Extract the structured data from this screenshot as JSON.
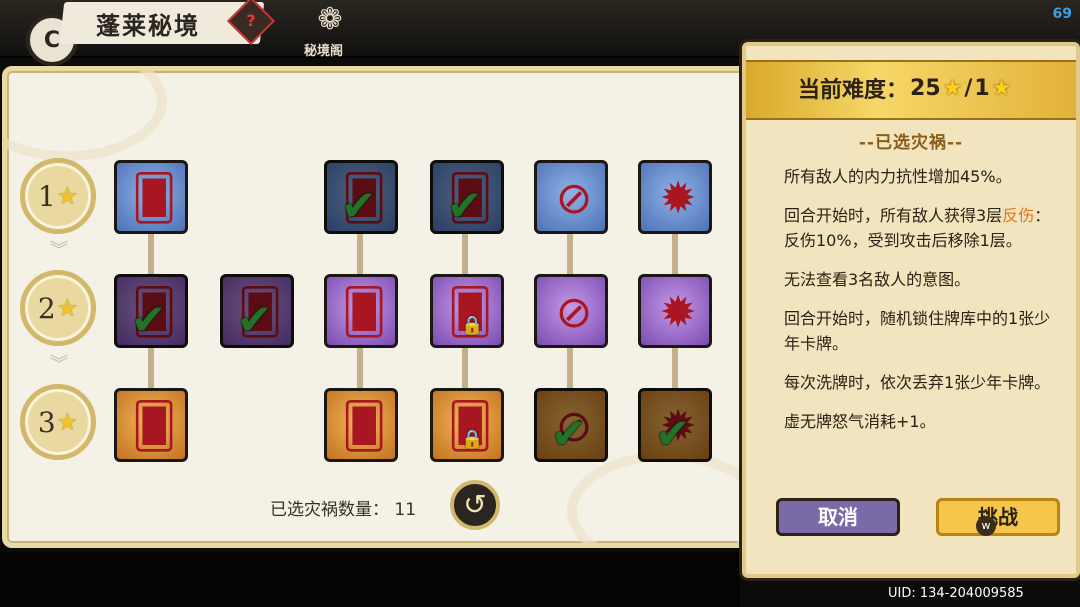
{
  "header": {
    "title": "蓬莱秘境",
    "help_icon": "?",
    "pavilion_label": "秘境阁",
    "corner_number": "69"
  },
  "levels": [
    {
      "num": "1",
      "star": "★"
    },
    {
      "num": "2",
      "star": "★"
    },
    {
      "num": "3",
      "star": "★"
    }
  ],
  "tiles": {
    "icons": {
      "card": "card-fan-icon",
      "eye": "crossed-eye-icon",
      "spike": "spiked-shell-icon",
      "check": "✔",
      "lock": "🔒"
    }
  },
  "footer": {
    "count_label": "已选灾祸数量：",
    "count_value": "11",
    "refresh_icon": "↺"
  },
  "detail": {
    "difficulty_label": "当前难度：",
    "difficulty_value_a": "25",
    "difficulty_sep": "/",
    "difficulty_value_b": "1",
    "star": "★",
    "heading": "--已选灾祸--",
    "effect_1": "所有敌人的内力抗性增加45%。",
    "effect_2a": "回合开始时，所有敌人获得3层",
    "effect_2_hl": "反伤",
    "effect_2b": "：反伤10%，受到攻击后移除1层。",
    "effect_3": "无法查看3名敌人的意图。",
    "effect_4": "回合开始时，随机锁住牌库中的1张少年卡牌。",
    "effect_5": "每次洗牌时，依次丢弃1张少年卡牌。",
    "effect_6": "虚无牌怒气消耗+1。",
    "cancel": "取消",
    "challenge": "挑战"
  },
  "uid": "UID: 134-204009585",
  "colors": {
    "blue_tile": "#5a7fc2",
    "purple_tile": "#9a6acb",
    "orange_tile": "#d98a2a",
    "check": "#3ed04a",
    "gold": "#f1c22e"
  }
}
